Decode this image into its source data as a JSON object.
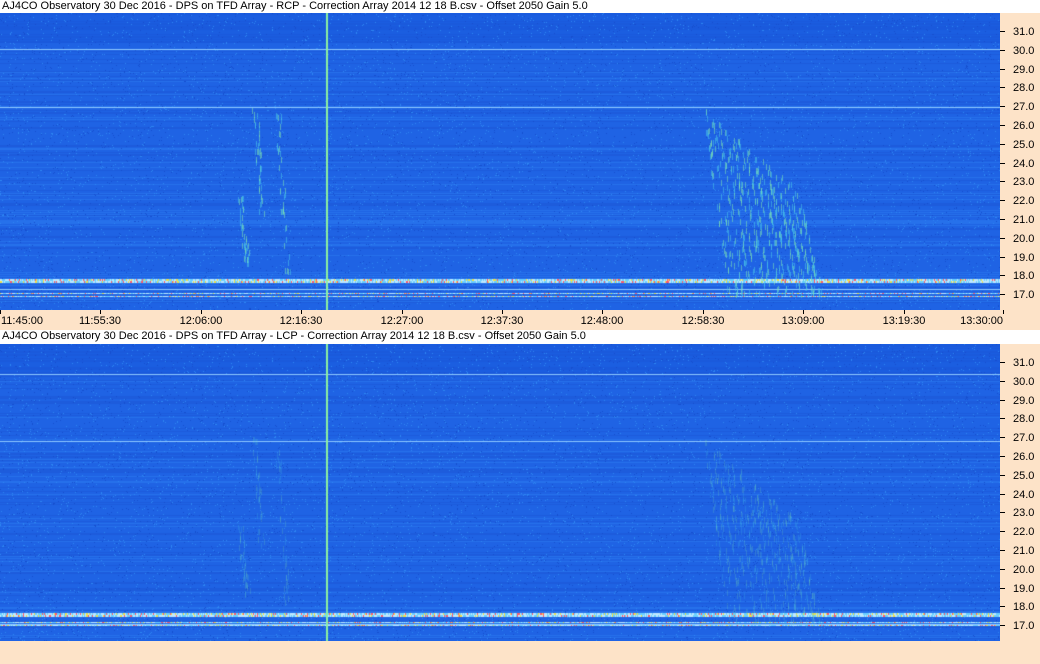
{
  "panels": [
    {
      "title": "AJ4CO Observatory 30 Dec 2016  -  DPS on TFD Array  -  RCP  -  Correction Array 2014 12 18 B.csv  -  Offset 2050  Gain 5.0",
      "polarization": "RCP",
      "y_ticks": [
        "31.0",
        "30.0",
        "29.0",
        "28.0",
        "27.0",
        "26.0",
        "25.0",
        "24.0",
        "23.0",
        "22.0",
        "21.0",
        "20.0",
        "19.0",
        "18.0",
        "17.0"
      ]
    },
    {
      "title": "AJ4CO Observatory 30 Dec 2016  -  DPS on TFD Array  -  LCP  -  Correction Array 2014 12 18 B.csv  -  Offset 2050  Gain 5.0",
      "polarization": "LCP",
      "y_ticks": [
        "31.0",
        "30.0",
        "29.0",
        "28.0",
        "27.0",
        "26.0",
        "25.0",
        "24.0",
        "23.0",
        "22.0",
        "21.0",
        "20.0",
        "19.0",
        "18.0",
        "17.0"
      ]
    }
  ],
  "x_axis": {
    "ticks": [
      "11:45:00",
      "11:55:30",
      "12:06:00",
      "12:16:30",
      "12:27:00",
      "12:37:30",
      "12:48:00",
      "12:58:30",
      "13:09:00",
      "13:19:30",
      "13:30:00"
    ]
  },
  "colors": {
    "background_blue": "#1e64e6",
    "axis_background": "#fde3c8"
  }
}
